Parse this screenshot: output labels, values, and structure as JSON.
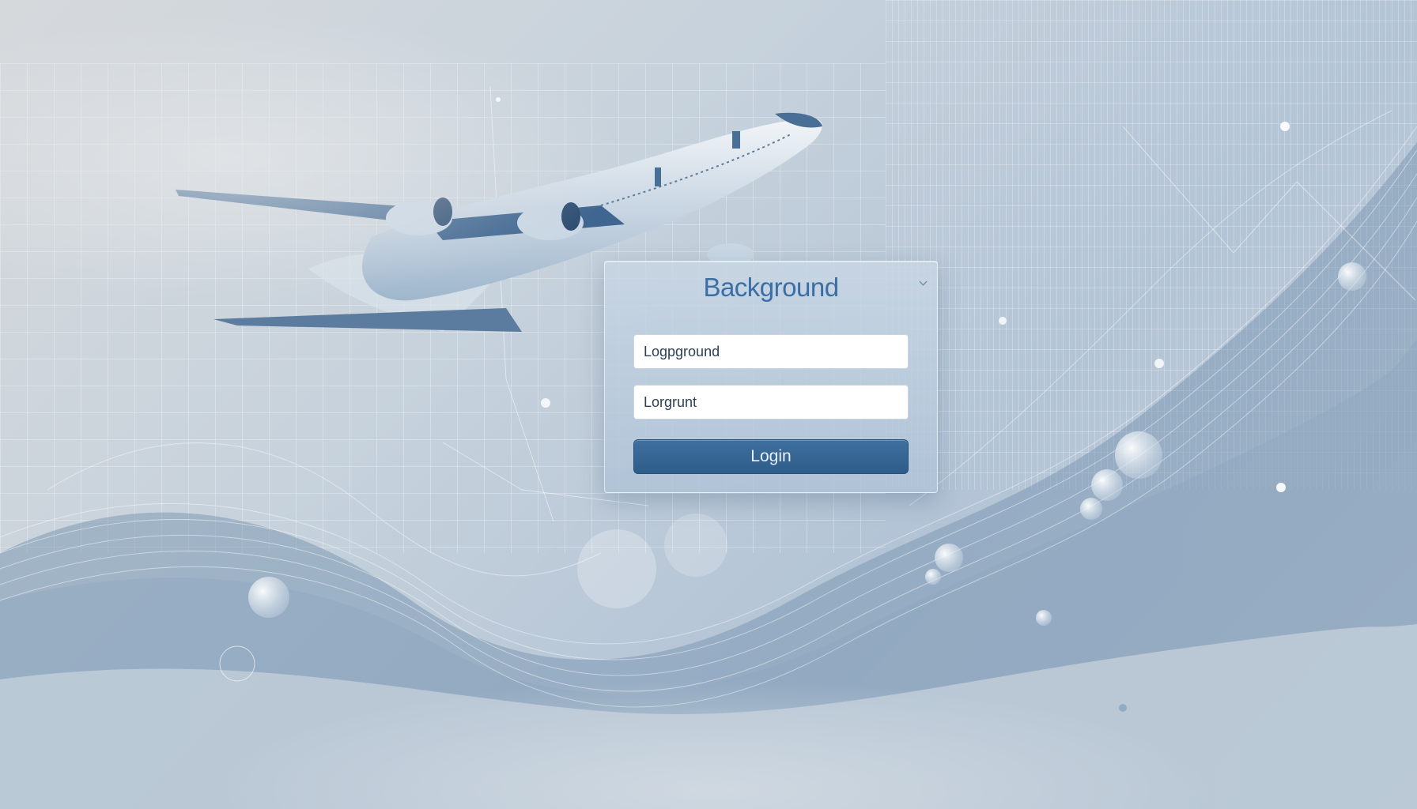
{
  "login": {
    "title": "Background",
    "username_value": "Logpground",
    "password_value": "Lorgrunt",
    "button_label": "Login"
  },
  "colors": {
    "accent": "#3a6ea5",
    "button": "#2f5d8a",
    "background": "#c7d2dc"
  }
}
